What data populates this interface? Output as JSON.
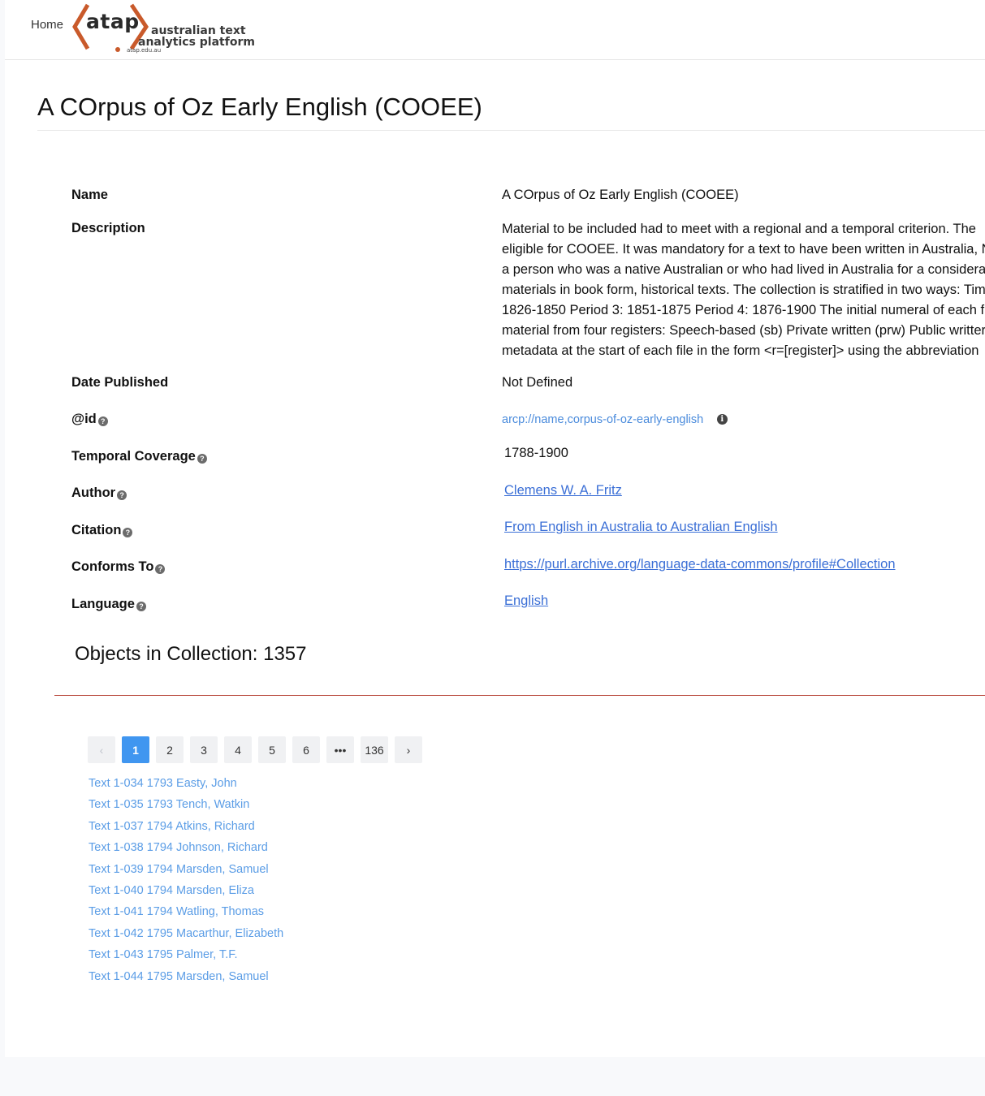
{
  "nav": {
    "home_label": "Home",
    "logo_word": "atap",
    "logo_line1": "australian text",
    "logo_line2": "analytics platform",
    "logo_url": "atap.edu.au",
    "logo_accent_color": "#c95a2b"
  },
  "page": {
    "title": "A COrpus of Oz Early English (COOEE)"
  },
  "metadata": {
    "name": {
      "label": "Name",
      "value": "A COrpus of Oz Early English (COOEE)"
    },
    "description": {
      "label": "Description",
      "lines": [
        "Material to be included had to meet with a regional and a temporal criterion. The",
        "eligible for COOEE. It was mandatory for a text to have been written in Australia, N",
        "a person who was a native Australian or who had lived in Australia for a considera",
        "materials in book form, historical texts. The collection is stratified in two ways: Tim",
        "1826-1850 Period 3: 1851-1875 Period 4: 1876-1900 The initial numeral of each fil",
        "material from four registers: Speech-based (sb) Private written (prw) Public writter",
        "metadata at the start of each file in the form <r=[register]> using the abbreviation"
      ]
    },
    "date_published": {
      "label": "Date Published",
      "value": "Not Defined"
    },
    "id": {
      "label": "@id",
      "value": "arcp://name,corpus-of-oz-early-english",
      "icon": "info-icon"
    },
    "temporal_coverage": {
      "label": "Temporal Coverage",
      "value": "1788-1900"
    },
    "author": {
      "label": "Author",
      "value": "Clemens W. A. Fritz"
    },
    "citation": {
      "label": "Citation",
      "value": "From English in Australia to Australian English"
    },
    "conforms_to": {
      "label": "Conforms To",
      "value": "https://purl.archive.org/language-data-commons/profile#Collection"
    },
    "language": {
      "label": "Language",
      "value": "English"
    },
    "help_icon": "?"
  },
  "collection": {
    "heading": "Objects in Collection: 1357",
    "rule_color": "#b33a2e"
  },
  "pagination": {
    "prev": "‹",
    "next": "›",
    "pages": [
      "1",
      "2",
      "3",
      "4",
      "5",
      "6",
      "•••",
      "136"
    ],
    "current": "1",
    "active_color": "#4096f0"
  },
  "items": [
    "Text 1-034 1793 Easty, John",
    "Text 1-035 1793 Tench, Watkin",
    "Text 1-037 1794 Atkins, Richard",
    "Text 1-038 1794 Johnson, Richard",
    "Text 1-039 1794 Marsden, Samuel",
    "Text 1-040 1794 Marsden, Eliza",
    "Text 1-041 1794 Watling, Thomas",
    "Text 1-042 1795 Macarthur, Elizabeth",
    "Text 1-043 1795 Palmer, T.F.",
    "Text 1-044 1795 Marsden, Samuel"
  ]
}
